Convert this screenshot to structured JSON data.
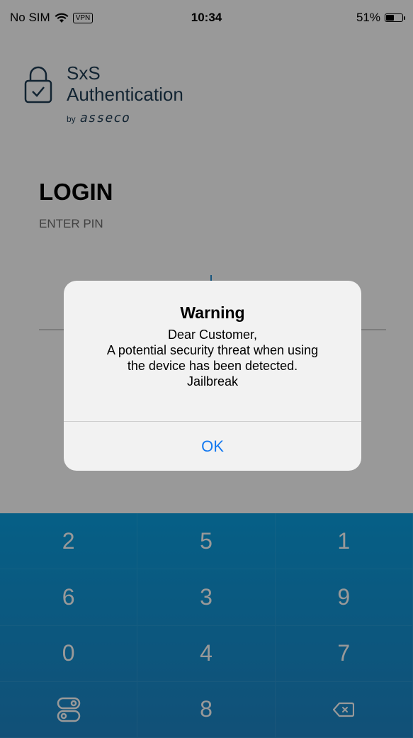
{
  "status_bar": {
    "carrier": "No SIM",
    "vpn": "VPN",
    "time": "10:34",
    "battery": "51%",
    "battery_level": 0.51
  },
  "app": {
    "name_line1": "SxS",
    "name_line2": "Authentication",
    "by": "by",
    "brand": "asseco"
  },
  "login": {
    "title": "LOGIN",
    "subtitle": "ENTER PIN"
  },
  "alert": {
    "title": "Warning",
    "lines": [
      "Dear Customer,",
      "A potential security threat when using",
      "the device has been detected.",
      "Jailbreak"
    ],
    "button": "OK"
  },
  "keypad": {
    "keys": [
      "2",
      "5",
      "1",
      "6",
      "3",
      "9",
      "0",
      "4",
      "7",
      "",
      "8",
      ""
    ],
    "bottom_left_icon": "switch-toggle-icon",
    "bottom_right_icon": "backspace-icon"
  },
  "colors": {
    "keypad_top": "#0a9fe0",
    "keypad_bottom": "#1e86c7",
    "accent_blue": "#1479f0",
    "brand_navy": "#1f3c54"
  }
}
